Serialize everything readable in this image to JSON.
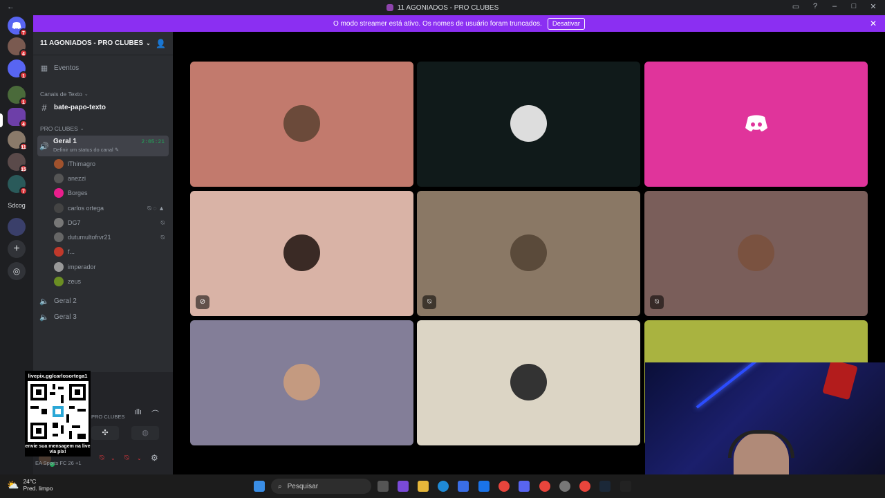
{
  "window": {
    "title": "11 AGONIADOS - PRO CLUBES",
    "back": "←"
  },
  "banner": {
    "text": "O modo streamer está ativo. Os nomes de usuário foram truncados.",
    "button": "Desativar",
    "close": "✕"
  },
  "guilds": [
    {
      "badge": "7"
    },
    {
      "badge": "4"
    },
    {
      "badge": "1"
    },
    {
      "badge": "1"
    },
    {
      "badge": "4"
    },
    {
      "badge": "11"
    },
    {
      "badge": "15"
    },
    {
      "badge": "7"
    }
  ],
  "guild_text": "Sdcog",
  "server": {
    "name": "11 AGONIADOS - PRO CLUBES",
    "events": "Eventos",
    "cat_text": "Canais de Texto",
    "text_channel": "bate-papo-texto",
    "cat_voice": "PRO CLUBES",
    "voice_active": "Geral 1",
    "voice_timer": "2:05:21",
    "voice_status": "Definir um status do canal",
    "voice2": "Geral 2",
    "voice3": "Geral 3"
  },
  "members": [
    {
      "name": "lThimagro",
      "color": "#a0522d"
    },
    {
      "name": "anezzi",
      "color": "#555"
    },
    {
      "name": "Borges",
      "color": "#e91e8c"
    },
    {
      "name": "carlos ortega",
      "color": "#444"
    },
    {
      "name": "DG7",
      "color": "#777"
    },
    {
      "name": "dutumultofrvr21",
      "color": "#666"
    },
    {
      "name": "f...",
      "color": "#c0392b"
    },
    {
      "name": "imperador",
      "color": "#999"
    },
    {
      "name": "zeus",
      "color": "#6b8e23"
    }
  ],
  "panel": {
    "conn_server": "PRO CLUBES",
    "user_activity": "EA Sports FC 26 +1",
    "username": "carlos ortega"
  },
  "qr": {
    "url": "livepix.gg/carlosortega1",
    "caption": "envie sua mensagem na live via pix!"
  },
  "tiles": [
    {
      "bg": "#c27a6d",
      "avatar": "#6b4a3a",
      "muted": false
    },
    {
      "bg": "#101a1a",
      "avatar": "#ddd",
      "muted": false
    },
    {
      "bg": "#e0349b",
      "avatar": "discord",
      "muted": false
    },
    {
      "bg": "#d9b3a6",
      "avatar": "#3a2a25",
      "muted": true
    },
    {
      "bg": "#8a7865",
      "avatar": "#5a4a3a",
      "muted": true
    },
    {
      "bg": "#7a5e5a",
      "avatar": "#7a5240",
      "muted": true
    },
    {
      "bg": "#837e98",
      "avatar": "#c49a80",
      "muted": false
    },
    {
      "bg": "#dcd5c5",
      "avatar": "#333",
      "muted": false
    },
    {
      "bg": "#a9b340",
      "avatar": "",
      "muted": false
    }
  ],
  "taskbar": {
    "temp": "24°C",
    "weather": "Pred. limpo",
    "search_placeholder": "Pesquisar"
  },
  "colors": {
    "accent": "#8b2ff2",
    "green": "#23a55a",
    "mute_red": "#da373c"
  }
}
